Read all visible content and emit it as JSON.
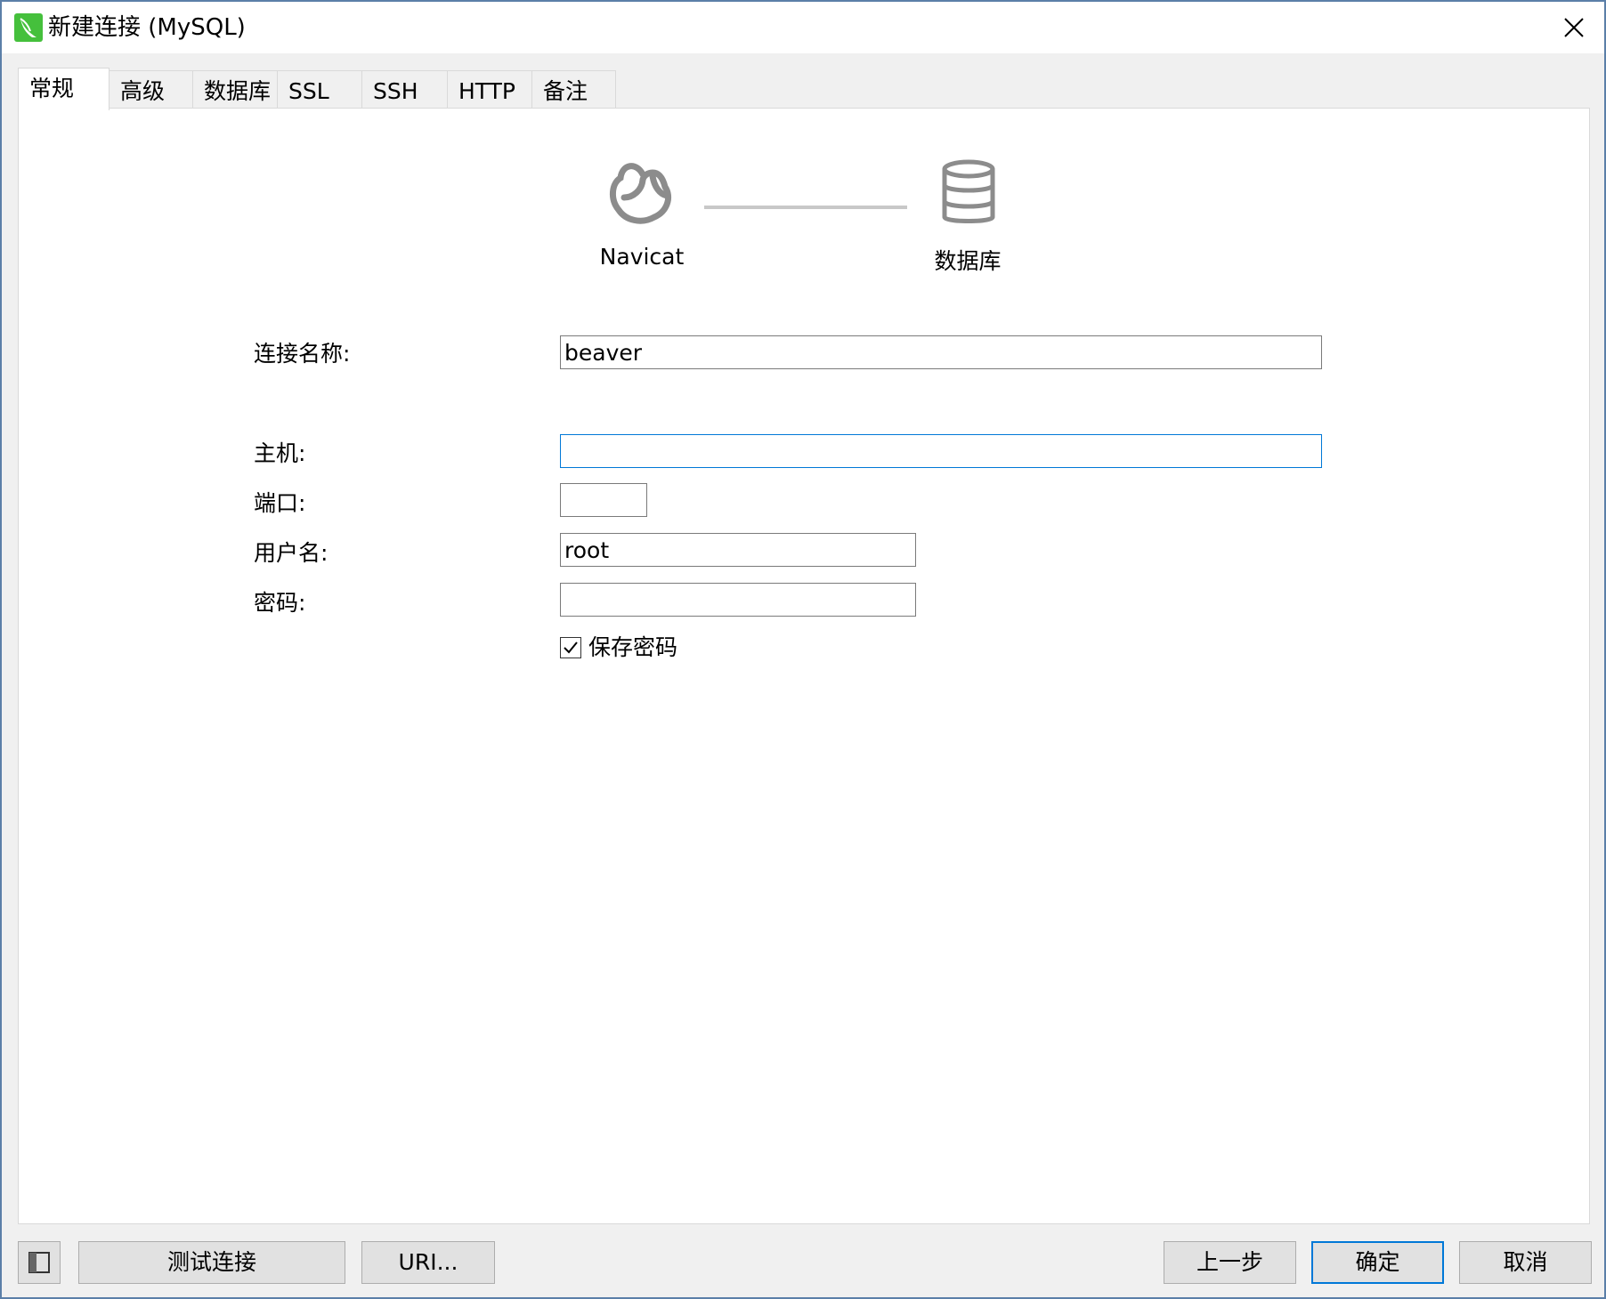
{
  "window": {
    "title": "新建连接 (MySQL)",
    "icon": "navicat-app-icon",
    "close_icon": "close-icon"
  },
  "tabs": [
    {
      "label": "常规",
      "active": true
    },
    {
      "label": "高级",
      "active": false
    },
    {
      "label": "数据库",
      "active": false
    },
    {
      "label": "SSL",
      "active": false
    },
    {
      "label": "SSH",
      "active": false
    },
    {
      "label": "HTTP",
      "active": false
    },
    {
      "label": "备注",
      "active": false
    }
  ],
  "diagram": {
    "left_label": "Navicat",
    "right_label": "数据库",
    "left_icon": "navicat-icon",
    "right_icon": "database-icon"
  },
  "form": {
    "connection_name": {
      "label": "连接名称:",
      "value": "beaver"
    },
    "host": {
      "label": "主机:",
      "value": ""
    },
    "port": {
      "label": "端口:",
      "value": ""
    },
    "username": {
      "label": "用户名:",
      "value": "root"
    },
    "password": {
      "label": "密码:",
      "value": ""
    },
    "save_password": {
      "label": "保存密码",
      "checked": true
    }
  },
  "buttons": {
    "test_connection": "测试连接",
    "uri": "URI...",
    "previous": "上一步",
    "ok": "确定",
    "cancel": "取消"
  },
  "colors": {
    "focus_border": "#0078d7",
    "app_icon_green": "#45c03c",
    "diagram_gray": "#8c8c8c"
  }
}
